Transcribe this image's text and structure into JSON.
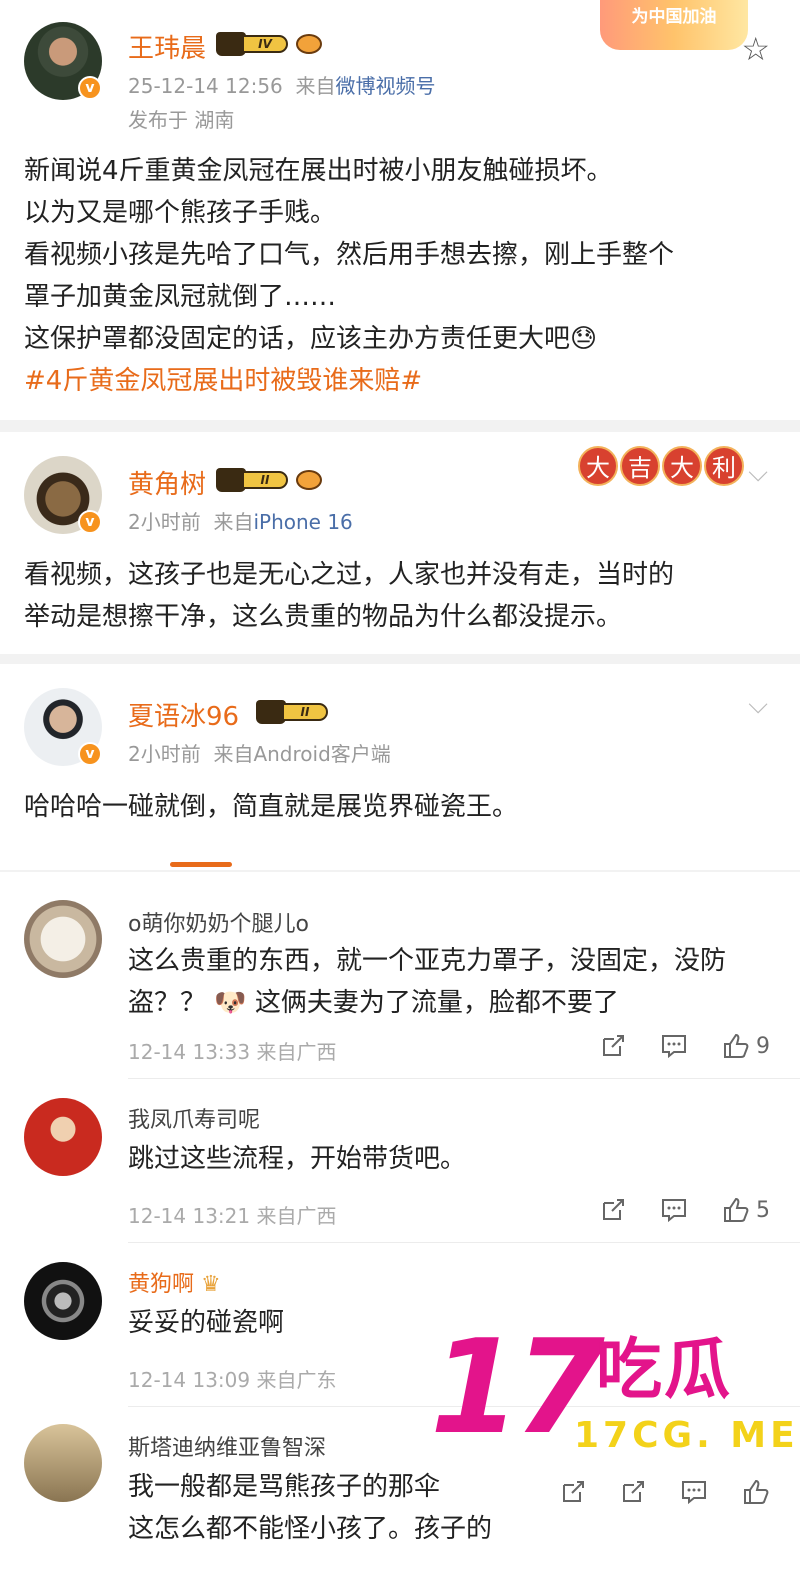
{
  "post": {
    "username": "王玮晨",
    "level": "IV",
    "time": "25-12-14 12:56",
    "from_prefix": "来自",
    "source": "微博视频号",
    "location": "发布于 湖南",
    "banner": "为中国加油",
    "lines": [
      "新闻说4斤重黄金凤冠在展出时被小朋友触碰损坏。",
      "以为又是哪个熊孩子手贱。",
      "看视频小孩是先哈了口气，然后用手想去擦，刚上手整个",
      "罩子加黄金凤冠就倒了……",
      "这保护罩都没固定的话，应该主办方责任更大吧😓"
    ],
    "topic": "#4斤黄金凤冠展出时被毁谁来赔#"
  },
  "reply1": {
    "username": "黄角树",
    "level": "II",
    "time": "2小时前",
    "from_prefix": "来自",
    "source": "iPhone 16",
    "lucky": [
      "大",
      "吉",
      "大",
      "利"
    ],
    "lines": [
      "看视频，这孩子也是无心之过，人家也并没有走，当时的",
      "举动是想擦干净，这么贵重的物品为什么都没提示。"
    ]
  },
  "reply2": {
    "username": "夏语冰96",
    "level": "II",
    "time": "2小时前",
    "from_prefix": "来自",
    "source": "Android客户端",
    "lines": [
      "哈哈哈一碰就倒，简直就是展览界碰瓷王。"
    ]
  },
  "comments": [
    {
      "name": "o萌你奶奶个腿儿o",
      "lines": [
        "这么贵重的东西，就一个亚克力罩子，没固定，没防",
        "盗？？ 🐶 这俩夫妻为了流量，脸都不要了"
      ],
      "meta": "12-14 13:33 来自广西",
      "likes": "9"
    },
    {
      "name": "我凤爪寿司呢",
      "lines": [
        "跳过这些流程，开始带货吧。"
      ],
      "meta": "12-14 13:21 来自广西",
      "likes": "5"
    },
    {
      "name": "黄狗啊",
      "lines": [
        "妥妥的碰瓷啊"
      ],
      "meta": "12-14 13:09 来自广东",
      "likes": ""
    },
    {
      "name": "斯塔迪纳维亚鲁智深",
      "lines": [
        "我一般都是骂熊孩子的那伞",
        "这怎么都不能怪小孩了。孩子的"
      ],
      "meta": "",
      "likes": ""
    }
  ],
  "watermark": {
    "number": "17",
    "name": "吃瓜",
    "url": "17CG. ME"
  },
  "colors": {
    "accent": "#e86b1a",
    "source_link": "#4a6ea8",
    "watermark": "#e3148b",
    "watermark_url": "#f3d21a"
  }
}
